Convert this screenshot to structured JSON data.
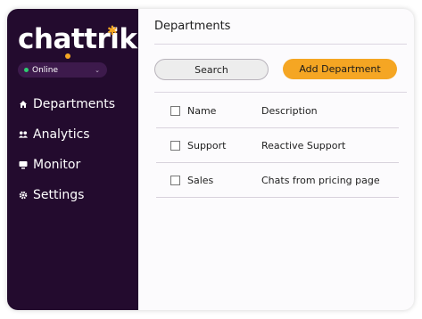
{
  "app": {
    "logo_text": "chattrik",
    "status": "Online"
  },
  "sidebar": {
    "items": [
      {
        "label": "Departments",
        "icon": "home-icon"
      },
      {
        "label": "Analytics",
        "icon": "users-icon"
      },
      {
        "label": "Monitor",
        "icon": "monitor-icon"
      },
      {
        "label": "Settings",
        "icon": "gear-icon"
      }
    ]
  },
  "main": {
    "title": "Departments",
    "search_label": "Search",
    "add_label": "Add Department",
    "table": {
      "headers": {
        "name": "Name",
        "description": "Description"
      },
      "rows": [
        {
          "name": "Support",
          "description": "Reactive Support"
        },
        {
          "name": "Sales",
          "description": "Chats from pricing page"
        }
      ]
    }
  },
  "colors": {
    "sidebar_bg": "#230b2e",
    "accent": "#f5a623",
    "status_dot": "#2ecc71"
  }
}
